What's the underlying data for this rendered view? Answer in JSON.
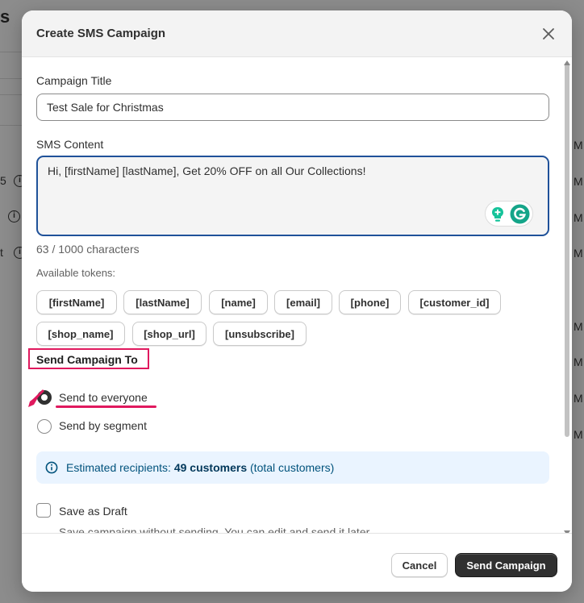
{
  "background": {
    "title_fragment": "s",
    "row_fragments": [
      "5",
      "t"
    ],
    "right_fragments": [
      "M",
      "M",
      "M",
      "M",
      "M",
      "M",
      "M",
      "M"
    ]
  },
  "modal": {
    "title": "Create SMS Campaign",
    "campaign_title": {
      "label": "Campaign Title",
      "value": "Test Sale for Christmas"
    },
    "sms_content": {
      "label": "SMS Content",
      "value": "Hi, [firstName] [lastName], Get 20% OFF on all Our Collections!",
      "char_count": "63 / 1000 characters"
    },
    "tokens": {
      "label": "Available tokens:",
      "items": [
        "[firstName]",
        "[lastName]",
        "[name]",
        "[email]",
        "[phone]",
        "[customer_id]",
        "[shop_name]",
        "[shop_url]",
        "[unsubscribe]"
      ]
    },
    "send_to": {
      "title": "Send Campaign To",
      "options": [
        {
          "label": "Send to everyone",
          "selected": true
        },
        {
          "label": "Send by segment",
          "selected": false
        }
      ]
    },
    "estimate": {
      "prefix": "Estimated recipients:",
      "count": "49 customers",
      "suffix": "(total customers)"
    },
    "draft": {
      "label": "Save as Draft",
      "help": "Save campaign without sending. You can edit and send it later",
      "checked": false
    },
    "footer": {
      "cancel": "Cancel",
      "send": "Send Campaign"
    }
  },
  "colors": {
    "accent_highlight": "#e0195e",
    "focus_border": "#1f5199",
    "primary_button": "#303030",
    "info_bg": "#eaf4ff",
    "grammarly_green": "#15c39a"
  },
  "icons": [
    "close-icon",
    "info-icon",
    "grammarly-icon",
    "lightbulb-icon",
    "pointer-arrow-icon"
  ]
}
